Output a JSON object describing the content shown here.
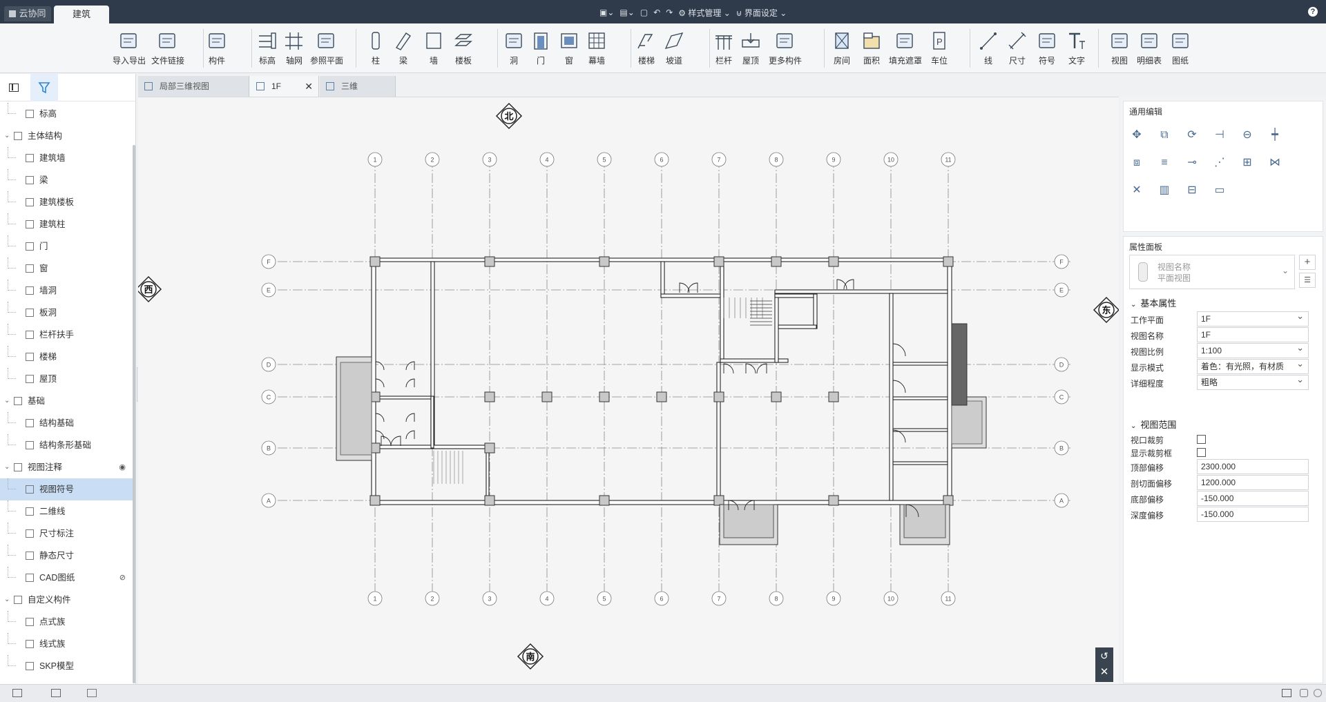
{
  "topbar": {
    "tabs": [
      "云协同",
      "建筑"
    ],
    "quick_actions": [
      "样式管理",
      "界面设定"
    ],
    "help": "?"
  },
  "ribbon": {
    "buttons": [
      {
        "label": "导入导出",
        "icon": "cad-import-export-icon"
      },
      {
        "label": "文件链接",
        "icon": "file-link-icon"
      },
      {
        "label": "构件",
        "icon": "component-icon"
      },
      {
        "label": "标高",
        "icon": "level-icon"
      },
      {
        "label": "轴网",
        "icon": "grid-icon"
      },
      {
        "label": "参照平面",
        "icon": "reference-plane-icon"
      },
      {
        "label": "柱",
        "icon": "column-icon"
      },
      {
        "label": "梁",
        "icon": "beam-icon"
      },
      {
        "label": "墙",
        "icon": "wall-icon"
      },
      {
        "label": "楼板",
        "icon": "slab-icon"
      },
      {
        "label": "洞",
        "icon": "opening-icon"
      },
      {
        "label": "门",
        "icon": "door-icon"
      },
      {
        "label": "窗",
        "icon": "window-icon"
      },
      {
        "label": "幕墙",
        "icon": "curtain-wall-icon"
      },
      {
        "label": "楼梯",
        "icon": "stair-icon"
      },
      {
        "label": "坡道",
        "icon": "ramp-icon"
      },
      {
        "label": "栏杆",
        "icon": "railing-icon"
      },
      {
        "label": "屋顶",
        "icon": "roof-icon"
      },
      {
        "label": "更多构件",
        "icon": "more-components-icon"
      },
      {
        "label": "房间",
        "icon": "room-icon"
      },
      {
        "label": "面积",
        "icon": "area-icon"
      },
      {
        "label": "填充遮罩",
        "icon": "fill-mask-icon"
      },
      {
        "label": "车位",
        "icon": "parking-icon"
      },
      {
        "label": "线",
        "icon": "line-icon"
      },
      {
        "label": "尺寸",
        "icon": "dimension-icon"
      },
      {
        "label": "符号",
        "icon": "symbol-icon"
      },
      {
        "label": "文字",
        "icon": "text-icon"
      },
      {
        "label": "视图",
        "icon": "view-icon"
      },
      {
        "label": "明细表",
        "icon": "schedule-icon"
      },
      {
        "label": "图纸",
        "icon": "sheet-icon"
      }
    ]
  },
  "tree": {
    "items": [
      {
        "label": "标高",
        "level": 1
      },
      {
        "label": "主体结构",
        "level": 0
      },
      {
        "label": "建筑墙",
        "level": 1
      },
      {
        "label": "梁",
        "level": 1
      },
      {
        "label": "建筑楼板",
        "level": 1
      },
      {
        "label": "建筑柱",
        "level": 1
      },
      {
        "label": "门",
        "level": 1
      },
      {
        "label": "窗",
        "level": 1
      },
      {
        "label": "墙洞",
        "level": 1
      },
      {
        "label": "板洞",
        "level": 1
      },
      {
        "label": "栏杆扶手",
        "level": 1
      },
      {
        "label": "楼梯",
        "level": 1
      },
      {
        "label": "屋顶",
        "level": 1
      },
      {
        "label": "基础",
        "level": 0
      },
      {
        "label": "结构基础",
        "level": 1
      },
      {
        "label": "结构条形基础",
        "level": 1
      },
      {
        "label": "视图注释",
        "level": 0
      },
      {
        "label": "视图符号",
        "level": 1
      },
      {
        "label": "二维线",
        "level": 1
      },
      {
        "label": "尺寸标注",
        "level": 1
      },
      {
        "label": "静态尺寸",
        "level": 1
      },
      {
        "label": "CAD图纸",
        "level": 1
      },
      {
        "label": "自定义构件",
        "level": 0
      },
      {
        "label": "点式族",
        "level": 1
      },
      {
        "label": "线式族",
        "level": 1
      },
      {
        "label": "SKP模型",
        "level": 1
      }
    ]
  },
  "view_tabs": [
    "局部三维视图",
    "1F",
    "三维"
  ],
  "compass": {
    "north": "北",
    "south": "南",
    "west": "西",
    "east": "东"
  },
  "axes": {
    "numbers": [
      "1",
      "2",
      "3",
      "4",
      "5",
      "6",
      "7",
      "8",
      "9",
      "10",
      "11"
    ],
    "letters": [
      "F",
      "E",
      "D",
      "C",
      "B",
      "A"
    ]
  },
  "general_edit": {
    "title": "通用编辑"
  },
  "properties": {
    "title": "属性面板",
    "view_name_box": {
      "line1": "视图名称",
      "line2": "平面视图"
    },
    "basic_section": "基本属性",
    "rows": [
      {
        "label": "工作平面",
        "value": "1F",
        "type": "select"
      },
      {
        "label": "视图名称",
        "value": "1F",
        "type": "text"
      },
      {
        "label": "视图比例",
        "value": "1:100",
        "type": "select"
      },
      {
        "label": "显示模式",
        "value": "着色：有光照，有材质",
        "type": "select"
      },
      {
        "label": "详细程度",
        "value": "粗略",
        "type": "select"
      }
    ],
    "range_section": "视图范围",
    "checks": [
      {
        "label": "视口裁剪",
        "checked": false
      },
      {
        "label": "显示裁剪框",
        "checked": false
      }
    ],
    "offsets": [
      {
        "label": "顶部偏移",
        "value": "2300.000"
      },
      {
        "label": "剖切面偏移",
        "value": "1200.000"
      },
      {
        "label": "底部偏移",
        "value": "-150.000"
      },
      {
        "label": "深度偏移",
        "value": "-150.000"
      }
    ]
  },
  "colors": {
    "topbar": "#2f3b4a",
    "selection": "#c9def5",
    "accent": "#2a86d9"
  }
}
